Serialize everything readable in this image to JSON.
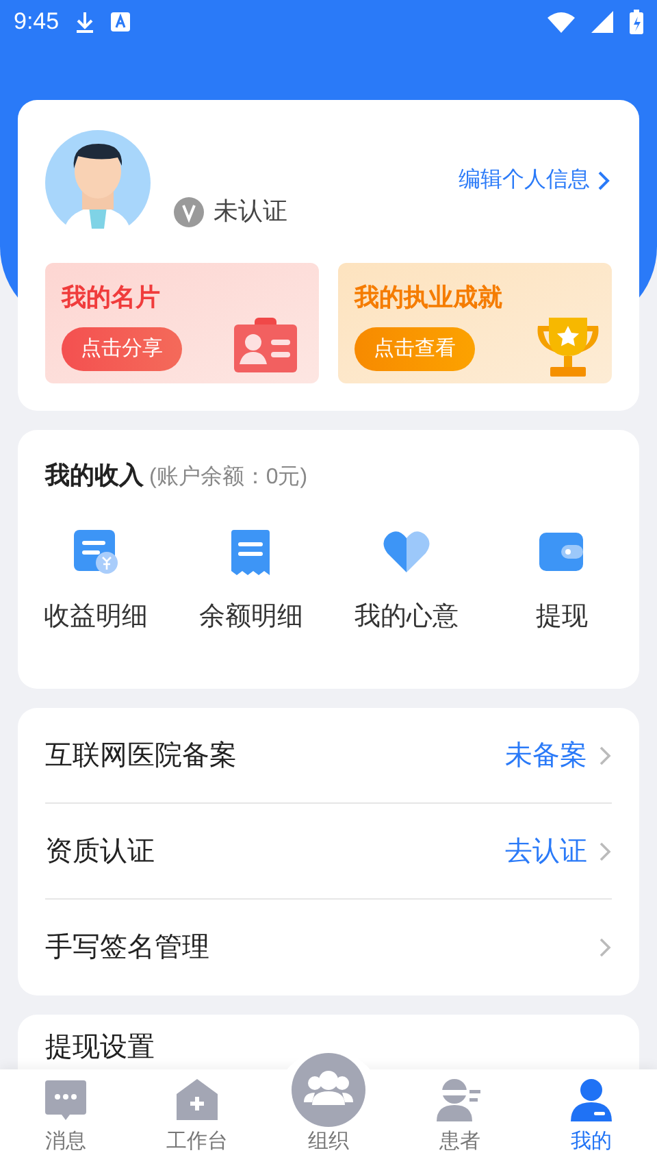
{
  "status_bar": {
    "time": "9:45"
  },
  "profile": {
    "status": "未认证",
    "verified": false,
    "edit_link": "编辑个人信息"
  },
  "promo_cards": [
    {
      "kind": "card",
      "title": "我的名片",
      "button": "点击分享"
    },
    {
      "kind": "trophy",
      "title": "我的执业成就",
      "button": "点击查看"
    }
  ],
  "income": {
    "title": "我的收入",
    "balance": "(账户余额：0元)",
    "actions": [
      {
        "kind": "bill",
        "label": "收益明细"
      },
      {
        "kind": "receipt",
        "label": "余额明细"
      },
      {
        "kind": "heart",
        "label": "我的心意"
      },
      {
        "kind": "wallet",
        "label": "提现"
      }
    ]
  },
  "menu": [
    {
      "label": "互联网医院备案",
      "value": "未备案"
    },
    {
      "label": "资质认证",
      "value": "去认证"
    },
    {
      "label": "手写签名管理"
    }
  ],
  "menu_2": [
    {
      "label": "提现设置"
    }
  ],
  "tab_bar": [
    {
      "kind": "chat",
      "label": "消息",
      "selected": false
    },
    {
      "kind": "house",
      "label": "工作台",
      "selected": false
    },
    {
      "kind": "group",
      "label": "组织",
      "selected": false
    },
    {
      "kind": "patient",
      "label": "患者",
      "selected": false
    },
    {
      "kind": "person",
      "label": "我的",
      "selected": true
    }
  ]
}
